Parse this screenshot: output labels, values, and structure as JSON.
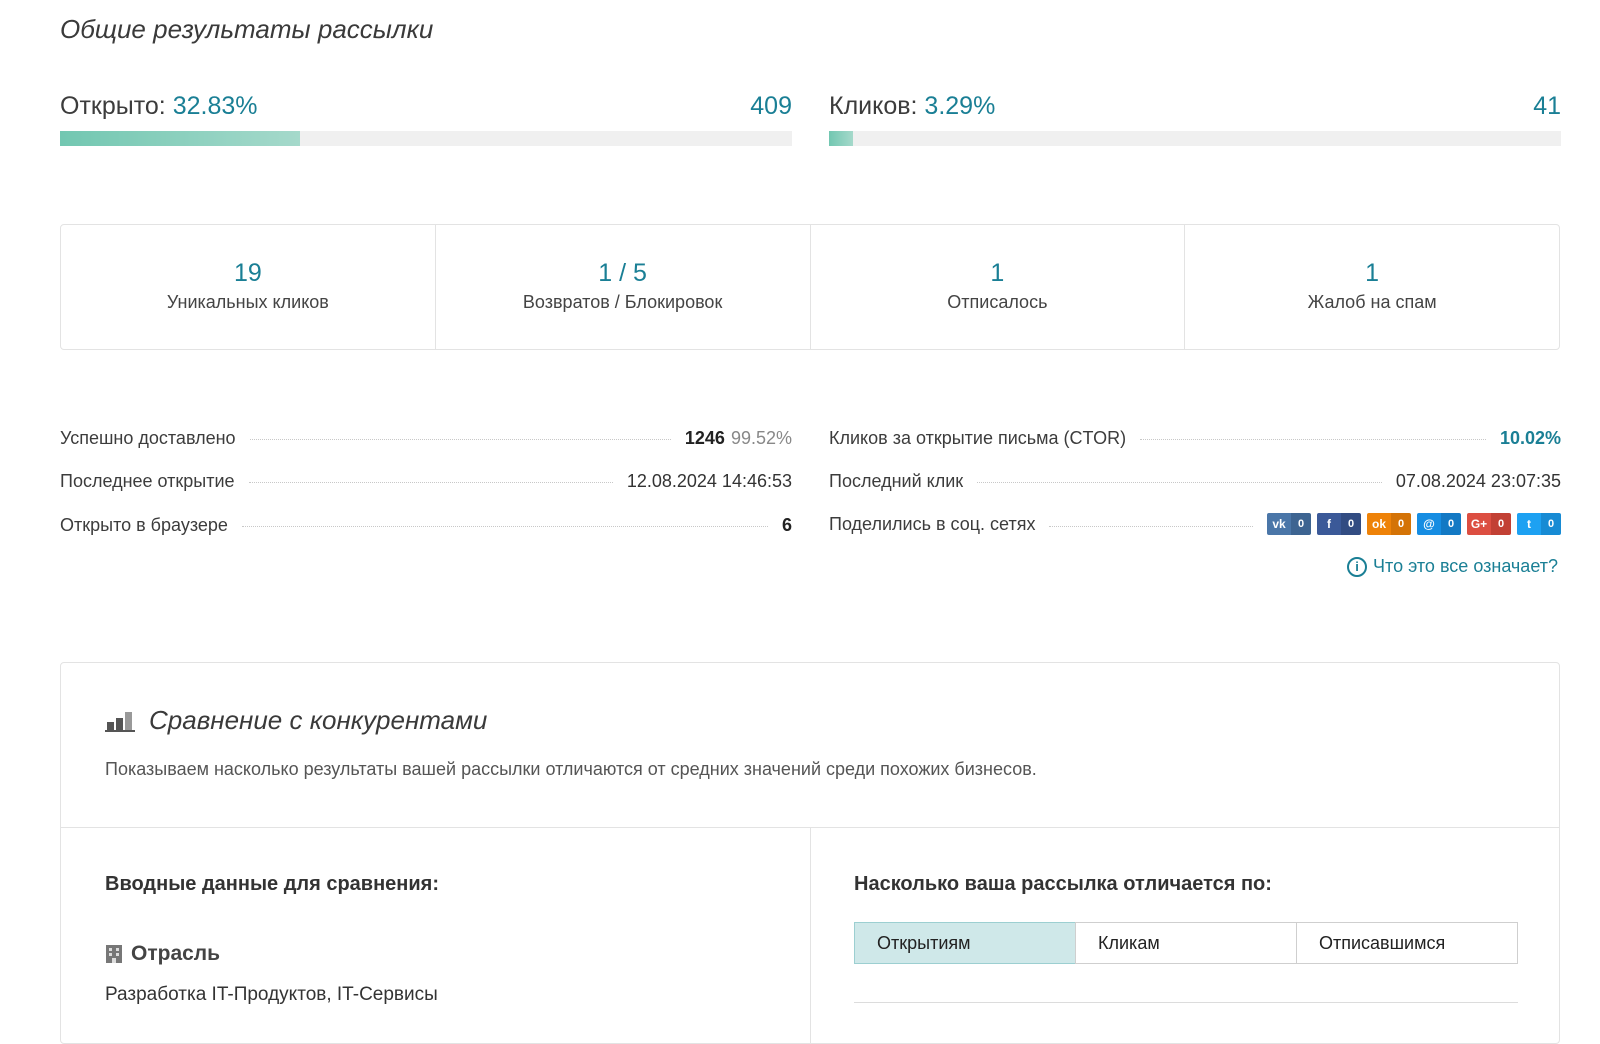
{
  "section_title": "Общие результаты рассылки",
  "opens": {
    "label": "Открыто:",
    "percent": "32.83%",
    "count": "409",
    "fill": 0.3283,
    "color": "#72c7b1"
  },
  "clicks": {
    "label": "Кликов:",
    "percent": "3.29%",
    "count": "41",
    "fill": 0.0329
  },
  "stats": [
    {
      "value": "19",
      "label": "Уникальных кликов"
    },
    {
      "value": "1 / 5",
      "label": "Возвратов / Блокировок"
    },
    {
      "value": "1",
      "label": "Отписалось"
    },
    {
      "value": "1",
      "label": "Жалоб на спам"
    }
  ],
  "left_details": {
    "delivered": {
      "label": "Успешно доставлено",
      "value": "1246",
      "percent": "99.52%"
    },
    "last_open": {
      "label": "Последнее открытие",
      "value": "12.08.2024 14:46:53"
    },
    "browser": {
      "label": "Открыто в браузере",
      "value": "6"
    }
  },
  "right_details": {
    "ctor": {
      "label": "Кликов за открытие письма (CTOR)",
      "value": "10.02%"
    },
    "last_click": {
      "label": "Последний клик",
      "value": "07.08.2024 23:07:35"
    },
    "shared": {
      "label": "Поделились в соц. сетях"
    }
  },
  "socials": [
    {
      "icon": "vk-icon",
      "glyph": "vk",
      "count": "0",
      "color": "#4a76a8",
      "dark": "#3d6491"
    },
    {
      "icon": "facebook-icon",
      "glyph": "f",
      "count": "0",
      "color": "#3b5998",
      "dark": "#324c82"
    },
    {
      "icon": "odnoklassniki-icon",
      "glyph": "ok",
      "count": "0",
      "color": "#ee8208",
      "dark": "#d47306"
    },
    {
      "icon": "myworld-icon",
      "glyph": "@",
      "count": "0",
      "color": "#168de2",
      "dark": "#1379c4"
    },
    {
      "icon": "googleplus-icon",
      "glyph": "G+",
      "count": "0",
      "color": "#dc4e41",
      "dark": "#c24034"
    },
    {
      "icon": "twitter-icon",
      "glyph": "t",
      "count": "0",
      "color": "#1da1f2",
      "dark": "#178bd4"
    }
  ],
  "help_link": "Что это все означает?",
  "comparison": {
    "title": "Сравнение с конкурентами",
    "description": "Показываем насколько результаты вашей рассылки отличаются от средних значений среди похожих бизнесов.",
    "input_title": "Вводные данные для сравнения:",
    "industry_label": "Отрасль",
    "industry_value": "Разработка IT-Продуктов, IT-Сервисы",
    "diff_title": "Насколько ваша рассылка отличается по:",
    "tabs": [
      "Открытиям",
      "Кликам",
      "Отписавшимся"
    ],
    "active_tab": "Открытиям"
  }
}
